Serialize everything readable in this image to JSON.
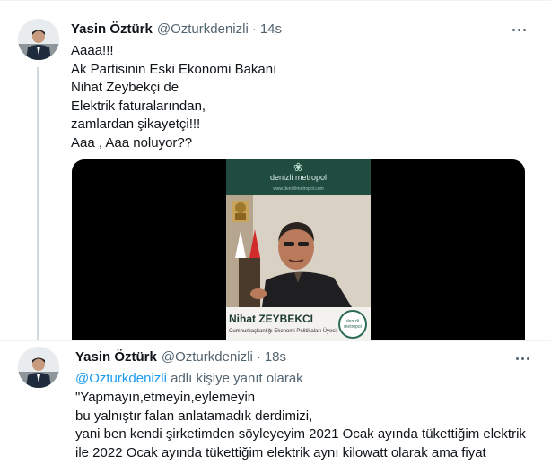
{
  "tweet1": {
    "author_name": "Yasin Öztürk",
    "author_handle": "@Ozturkdenizli",
    "separator": "·",
    "timestamp": "14s",
    "text": "Aaaa!!!\nAk Partisinin Eski Ekonomi Bakanı\nNihat Zeybekçi de\nElektrik faturalarından,\nzamlardan şikayetçi!!!\nAaa , Aaa noluyor??",
    "media": {
      "brand": "denizli metropol",
      "url_text": "www.denizlimetropol.com",
      "caption_first": "Nihat ",
      "caption_last": "ZEYBEKCI",
      "caption_title": "Cumhurbaşkanlığı Ekonomi Politikaları Üyesi",
      "badge_text": "denizli metropol"
    }
  },
  "tweet2": {
    "author_name": "Yasin Öztürk",
    "author_handle": "@Ozturkdenizli",
    "separator": "·",
    "timestamp": "18s",
    "reply_mention": "@Ozturkdenizli",
    "reply_suffix": " adlı kişiye yanıt olarak",
    "text": "\"Yapmayın,etmeyin,eylemeyin\nbu yalnıştır falan anlatamadık derdimizi,\nyani ben kendi şirketimden söyleyeyim 2021 Ocak ayında tükettiğim elektrik\nile 2022 Ocak ayında tükettiğim elektrik aynı kilowatt olarak ama fiyat\nolarak baktığımız zaman iki katı.\""
  },
  "colors": {
    "text": "#0f1419",
    "secondary": "#536471",
    "link": "#1d9bf0",
    "thread_line": "#cfd9de"
  },
  "icons": [
    "more-icon",
    "avatar-image"
  ]
}
